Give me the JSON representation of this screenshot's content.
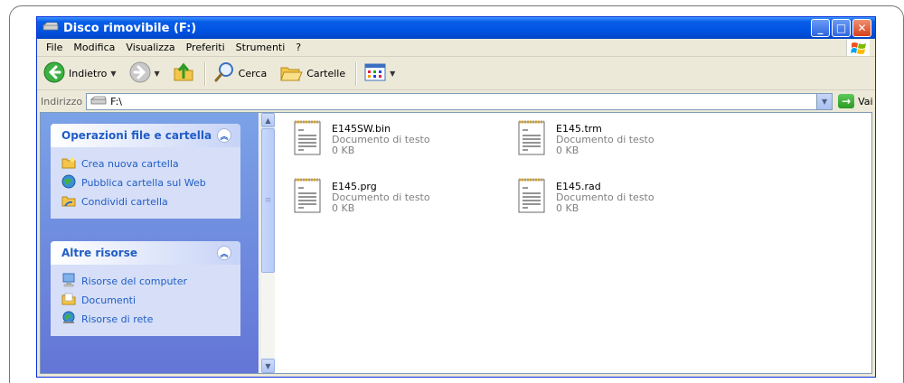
{
  "window": {
    "title": "Disco rimovibile (F:)",
    "buttons": {
      "minimize": "_",
      "maximize": "□",
      "close": "✕"
    }
  },
  "menu": [
    "File",
    "Modifica",
    "Visualizza",
    "Preferiti",
    "Strumenti",
    "?"
  ],
  "toolbar": {
    "back_label": "Indietro",
    "search_label": "Cerca",
    "folders_label": "Cartelle"
  },
  "address": {
    "label": "Indirizzo",
    "value": "F:\\",
    "go_label": "Vai"
  },
  "task_panes": [
    {
      "title": "Operazioni file e cartella",
      "links": [
        {
          "label": "Crea nuova cartella",
          "icon": "new-folder-icon"
        },
        {
          "label": "Pubblica cartella sul Web",
          "icon": "publish-web-icon"
        },
        {
          "label": "Condividi cartella",
          "icon": "share-folder-icon"
        }
      ]
    },
    {
      "title": "Altre risorse",
      "links": [
        {
          "label": "Risorse del computer",
          "icon": "my-computer-icon"
        },
        {
          "label": "Documenti",
          "icon": "documents-folder-icon"
        },
        {
          "label": "Risorse di rete",
          "icon": "network-places-icon"
        }
      ]
    }
  ],
  "files": [
    {
      "name": "E145SW.bin",
      "type": "Documento di testo",
      "size": "0 KB"
    },
    {
      "name": "E145.trm",
      "type": "Documento di testo",
      "size": "0 KB"
    },
    {
      "name": "E145.prg",
      "type": "Documento di testo",
      "size": "0 KB"
    },
    {
      "name": "E145.rad",
      "type": "Documento di testo",
      "size": "0 KB"
    }
  ],
  "colors": {
    "titlebar": "#0054e3",
    "taskpane": "#6375d6",
    "link": "#215dc6"
  }
}
